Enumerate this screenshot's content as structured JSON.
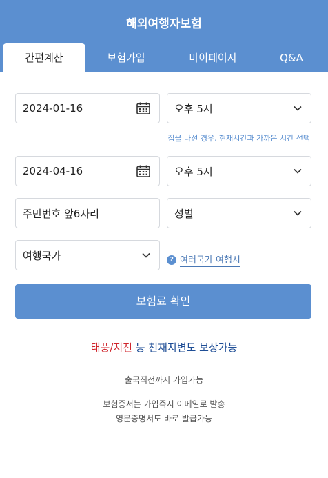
{
  "header": {
    "title": "해외여행자보험",
    "tabs": [
      {
        "label": "간편계산"
      },
      {
        "label": "보험가입"
      },
      {
        "label": "마이페이지"
      },
      {
        "label": "Q&A"
      }
    ],
    "colors": {
      "accent": "#5b8fd0",
      "promo_red": "#d0262d",
      "promo_blue": "#1f4e96"
    }
  },
  "form": {
    "start_date": "2024-01-16",
    "start_time": "오후 5시",
    "time_hint": "집을 나선 경우, 현재시간과 가까운 시간 선택",
    "end_date": "2024-04-16",
    "end_time": "오후 5시",
    "id_placeholder": "주민번호 앞6자리",
    "gender_placeholder": "성별",
    "country_placeholder": "여행국가",
    "multi_country_link": "여러국가 여행시",
    "submit_label": "보험료 확인"
  },
  "promo": {
    "highlight": "태풍/지진",
    "rest": " 등 천재지변도 보상가능"
  },
  "notes": {
    "line1": "출국직전까지 가입가능",
    "line2": "보험증서는 가입즉시 이메일로 발송",
    "line3": "영문증명서도 바로 발급가능"
  },
  "icons": {
    "calendar": "calendar-icon",
    "chevron": "chevron-down-icon",
    "help": "question-icon"
  }
}
